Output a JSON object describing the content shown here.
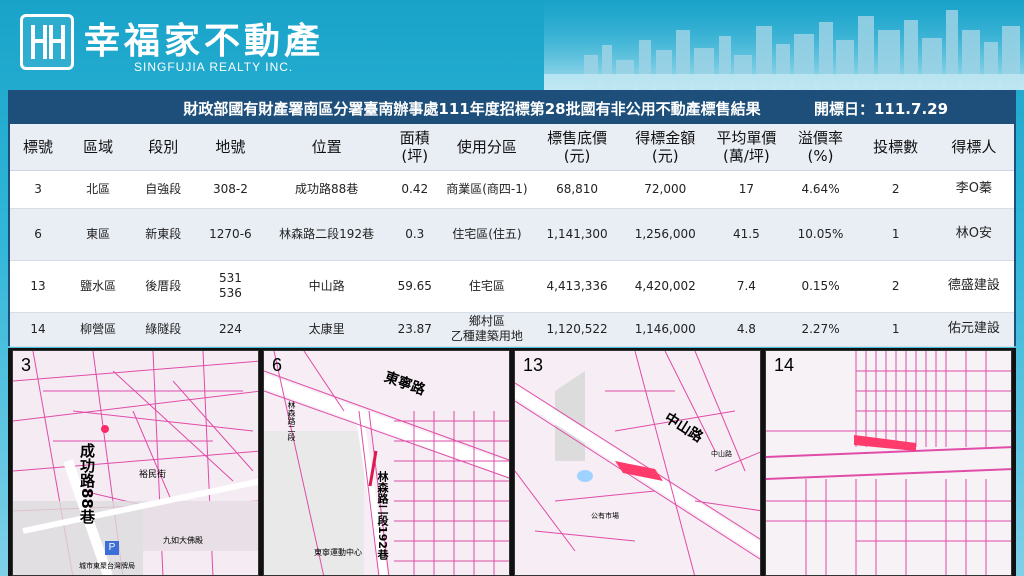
{
  "brand": {
    "name_cn": "幸福家不動產",
    "name_en": "SINGFUJIA REALTY INC."
  },
  "title_bar": {
    "title": "財政部國有財產署南區分署臺南辦事處111年度招標第28批國有非公用不動產標售結果",
    "date": "開標日：111.7.29"
  },
  "table": {
    "headers": [
      "標號",
      "區域",
      "段別",
      "地號",
      "位置",
      "面積\n(坪)",
      "使用分區",
      "標售底價\n(元)",
      "得標金額\n(元)",
      "平均單價\n(萬/坪)",
      "溢價率\n(%)",
      "投標數",
      "得標人"
    ],
    "rows": [
      [
        "3",
        "北區",
        "自強段",
        "308-2",
        "成功路88巷",
        "0.42",
        "商業區(商四-1)",
        "68,810",
        "72,000",
        "17",
        "4.64%",
        "2",
        "李O蓁"
      ],
      [
        "6",
        "東區",
        "新東段",
        "1270-6",
        "林森路二段192巷",
        "0.3",
        "住宅區(住五)",
        "1,141,300",
        "1,256,000",
        "41.5",
        "10.05%",
        "1",
        "林O安"
      ],
      [
        "13",
        "鹽水區",
        "後厝段",
        "531\n536",
        "中山路",
        "59.65",
        "住宅區",
        "4,413,336",
        "4,420,002",
        "7.4",
        "0.15%",
        "2",
        "德盛建設"
      ],
      [
        "14",
        "柳營區",
        "綠隧段",
        "224",
        "太康里",
        "23.87",
        "鄉村區\n乙種建築用地",
        "1,120,522",
        "1,146,000",
        "4.8",
        "2.27%",
        "1",
        "佑元建設"
      ]
    ]
  },
  "maps": [
    {
      "number": "3",
      "road": "成功路88巷",
      "street2": "裕民街",
      "poi": "九如大佛殿",
      "poi2": "城市東聚台灣牌局",
      "icon": "parking-icon"
    },
    {
      "number": "6",
      "road": "東寧路",
      "road2": "林森路二段192巷",
      "street2": "林森路二段",
      "poi": "東寧運動中心"
    },
    {
      "number": "13",
      "road": "中山路",
      "street2": "中山路",
      "poi": "公有市場"
    },
    {
      "number": "14"
    }
  ]
}
